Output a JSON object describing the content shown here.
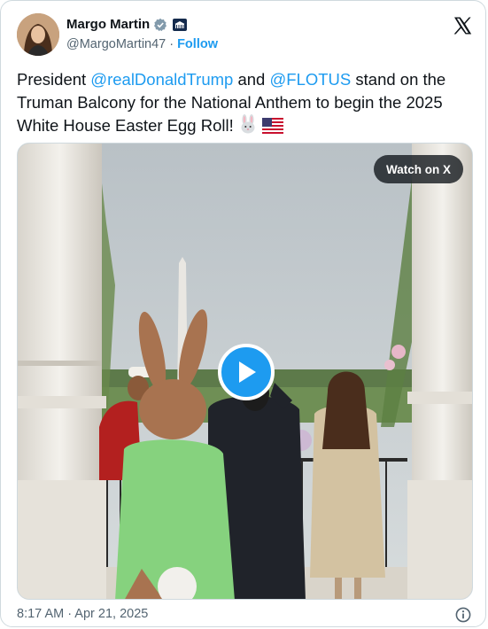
{
  "author": {
    "name": "Margo Martin",
    "handle": "@MargoMartin47",
    "separator": "·",
    "follow_label": "Follow"
  },
  "post": {
    "text_1": "President ",
    "mention_1": "@realDonaldTrump",
    "text_2": " and ",
    "mention_2": "@FLOTUS",
    "text_3": "  stand on the Truman Balcony for the National Anthem to begin the 2025 White House Easter Egg Roll! ",
    "emoji": [
      "rabbit-face",
      "us-flag"
    ]
  },
  "media": {
    "watch_label": "Watch on X",
    "play_icon": "play-icon"
  },
  "footer": {
    "timestamp": "8:17 AM · Apr 21, 2025"
  },
  "colors": {
    "accent": "#1d9bf0",
    "text": "#0f1419",
    "secondary": "#536471",
    "border": "#cfd9de"
  }
}
